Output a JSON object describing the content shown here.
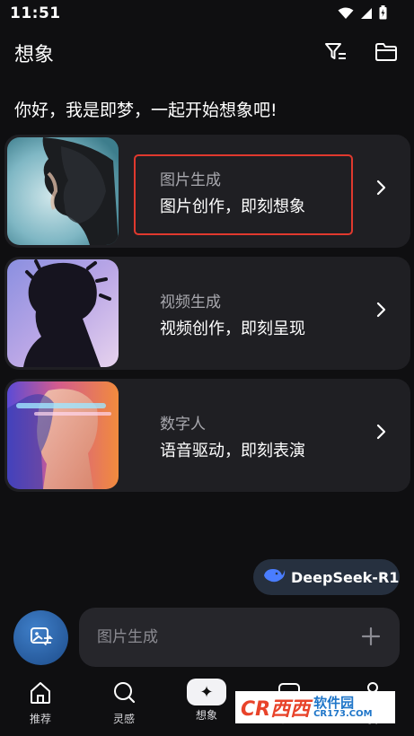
{
  "status": {
    "time": "11:51"
  },
  "header": {
    "title": "想象"
  },
  "greeting": "你好，我是即梦，一起开始想象吧!",
  "cards": [
    {
      "title": "图片生成",
      "subtitle": "图片创作，即刻想象"
    },
    {
      "title": "视频生成",
      "subtitle": "视频创作，即刻呈现"
    },
    {
      "title": "数字人",
      "subtitle": "语音驱动，即刻表演"
    }
  ],
  "model": {
    "label": "DeepSeek-R1"
  },
  "prompt": {
    "placeholder": "图片生成"
  },
  "nav": [
    {
      "label": "推荐"
    },
    {
      "label": "灵感"
    },
    {
      "label": "想象",
      "active": true
    },
    {
      "label": "消息"
    },
    {
      "label": "我"
    }
  ],
  "watermark": {
    "main": "CR西西",
    "cn": "软件园",
    "url": "CR173.COM"
  },
  "colors": {
    "highlight": "#e0392e",
    "card_bg": "#1f1f23",
    "accent_blue": "#3f7fc9"
  }
}
